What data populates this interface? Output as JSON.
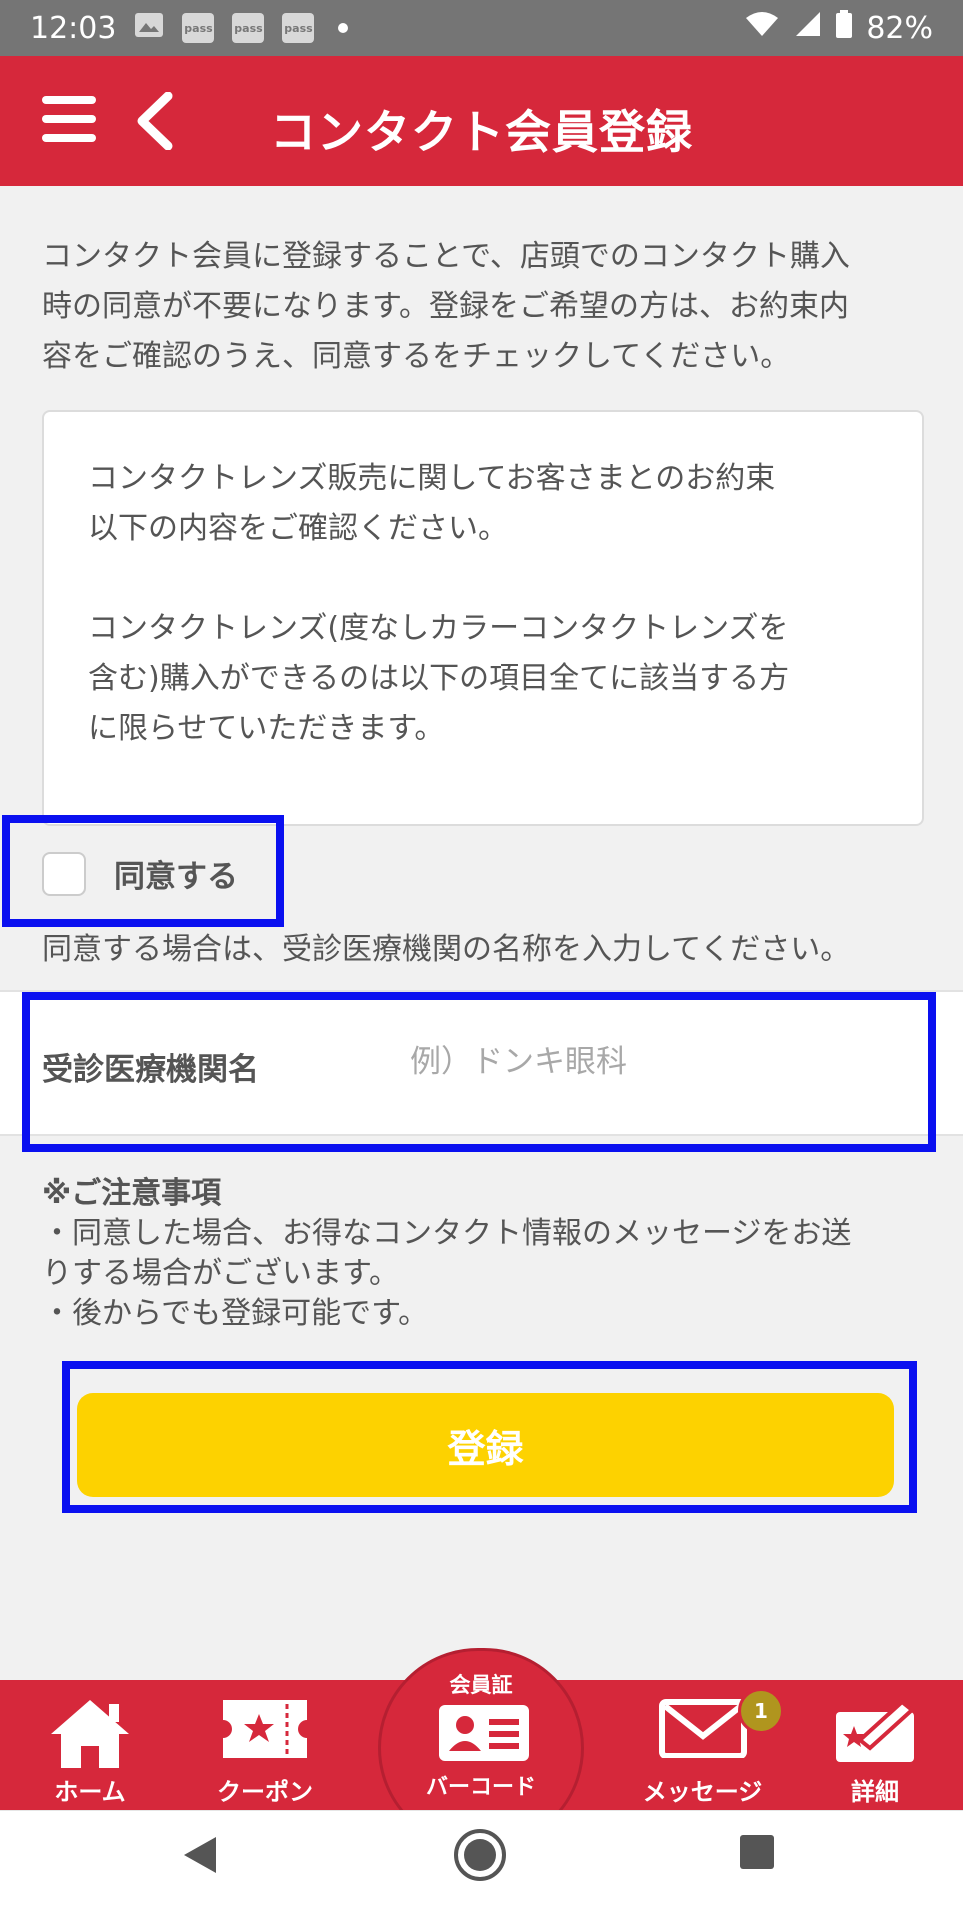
{
  "status_bar": {
    "time": "12:03",
    "notification_labels": [
      "pass",
      "pass",
      "pass"
    ],
    "battery": "82%"
  },
  "header": {
    "title": "コンタクト会員登録",
    "menu_icon": "hamburger-icon",
    "back_icon": "chevron-left-icon"
  },
  "intro_lines": [
    "コンタクト会員に登録することで、店頭でのコンタクト購入",
    "時の同意が不要になります。登録をご希望の方は、お約束内",
    "容をご確認のうえ、同意するをチェックしてください。"
  ],
  "terms": {
    "para1_lines": [
      "コンタクトレンズ販売に関してお客さまとのお約束",
      "以下の内容をご確認ください。"
    ],
    "para2_lines": [
      "コンタクトレンズ(度なしカラーコンタクトレンズを",
      "含む)購入ができるのは以下の項目全てに該当する方",
      "に限らせていただきます。"
    ]
  },
  "agree": {
    "label": "同意する",
    "checked": false,
    "note": "同意する場合は、受診医療機関の名称を入力してください。"
  },
  "clinic_field": {
    "label": "受診医療機関名",
    "value": "",
    "placeholder": "例）ドンキ眼科"
  },
  "notice": {
    "title": "※ご注意事項",
    "lines": [
      "・同意した場合、お得なコンタクト情報のメッセージをお送",
      "りする場合がございます。",
      "・後からでも登録可能です。"
    ]
  },
  "submit_label": "登録",
  "tab_bar": {
    "home": "ホーム",
    "coupon": "クーポン",
    "member_card_top": "会員証",
    "barcode": "バーコード",
    "message": "メッセージ",
    "message_badge": "1",
    "details": "詳細"
  },
  "colors": {
    "brand_red": "#d6283b",
    "submit_yellow": "#fdd200",
    "highlight_blue": "#0a10f0"
  }
}
